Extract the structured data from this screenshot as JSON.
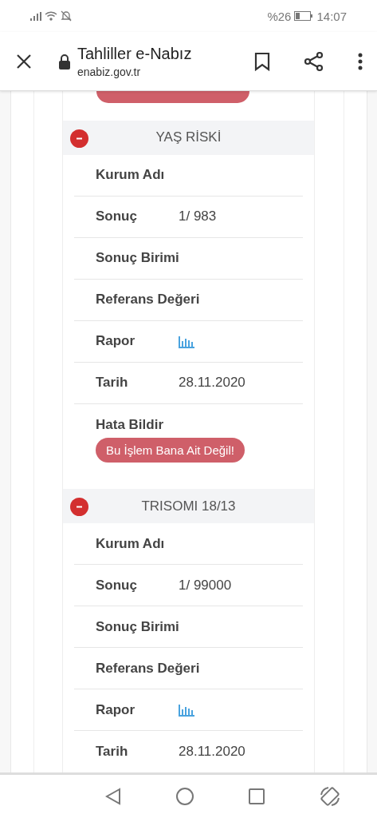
{
  "status_bar": {
    "battery_text": "%26",
    "time": "14:07"
  },
  "browser_bar": {
    "title": "Tahliller e-Nabız",
    "url": "enabiz.gov.tr"
  },
  "sections": [
    {
      "title": "YAŞ RİSKİ",
      "expanded": true,
      "rows": [
        {
          "kind": "text",
          "label": "Kurum Adı"
        },
        {
          "kind": "text",
          "label": "Sonuç",
          "value": "1/ 983"
        },
        {
          "kind": "text",
          "label": "Sonuç Birimi"
        },
        {
          "kind": "text",
          "label": "Referans Değeri"
        },
        {
          "kind": "report",
          "label": "Rapor"
        },
        {
          "kind": "text",
          "label": "Tarih",
          "value": "28.11.2020"
        },
        {
          "kind": "error",
          "label": "Hata Bildir",
          "button": "Bu İşlem Bana Ait Değil!"
        }
      ]
    },
    {
      "title": "TRISOMI 18/13",
      "expanded": true,
      "rows": [
        {
          "kind": "text",
          "label": "Kurum Adı"
        },
        {
          "kind": "text",
          "label": "Sonuç",
          "value": "1/ 99000"
        },
        {
          "kind": "text",
          "label": "Sonuç Birimi"
        },
        {
          "kind": "text",
          "label": "Referans Değeri"
        },
        {
          "kind": "report",
          "label": "Rapor"
        },
        {
          "kind": "text",
          "label": "Tarih",
          "value": "28.11.2020"
        }
      ]
    }
  ]
}
